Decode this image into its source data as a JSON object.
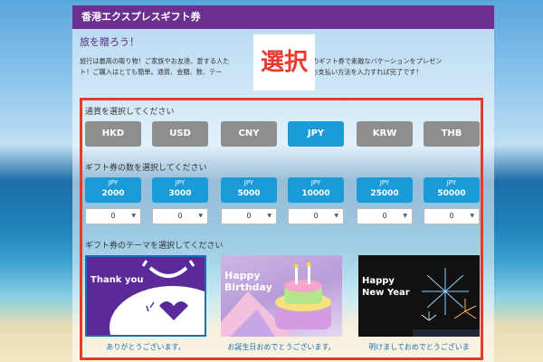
{
  "header": {
    "title": "香港エクスプレスギフト券"
  },
  "intro": {
    "title": "旅を贈ろう！",
    "line1": "旅行は最高の贈り物！ご家族やお友達、愛する人た",
    "line1b": "プレスのギフト券で素敵なバケーションをプレゼン",
    "line1c": "ト！ご購入はとても簡単。通貨、金額、数、テー",
    "line1d": "様情報とお支払い方法を入力すれば完了です！"
  },
  "stamp": {
    "label": "選択"
  },
  "currency": {
    "label": "通貨を選択してください",
    "options": [
      "HKD",
      "USD",
      "CNY",
      "JPY",
      "KRW",
      "THB"
    ],
    "selected": "JPY"
  },
  "denominations": {
    "label": "ギフト券の数を選択してください",
    "currency_code": "JPY",
    "items": [
      {
        "amount": "2000",
        "qty": "0"
      },
      {
        "amount": "3000",
        "qty": "0"
      },
      {
        "amount": "5000",
        "qty": "0"
      },
      {
        "amount": "10000",
        "qty": "0"
      },
      {
        "amount": "25000",
        "qty": "0"
      },
      {
        "amount": "50000",
        "qty": "0"
      }
    ]
  },
  "themes": {
    "label": "ギフト券のテーマを選択してください",
    "items": [
      {
        "card_text": "Thank you",
        "caption": "ありがとうございます。"
      },
      {
        "card_text_1": "Happy",
        "card_text_2": "Birthday",
        "caption": "お誕生日おめでとうございます。"
      },
      {
        "card_text_1": "Happy",
        "card_text_2": "New Year",
        "caption": "明けましておめでとうございま"
      }
    ]
  },
  "colors": {
    "header": "#6a2f8f",
    "accent": "#1a9ad6",
    "button_grey": "#8e8e8e",
    "highlight": "#e8392b"
  }
}
